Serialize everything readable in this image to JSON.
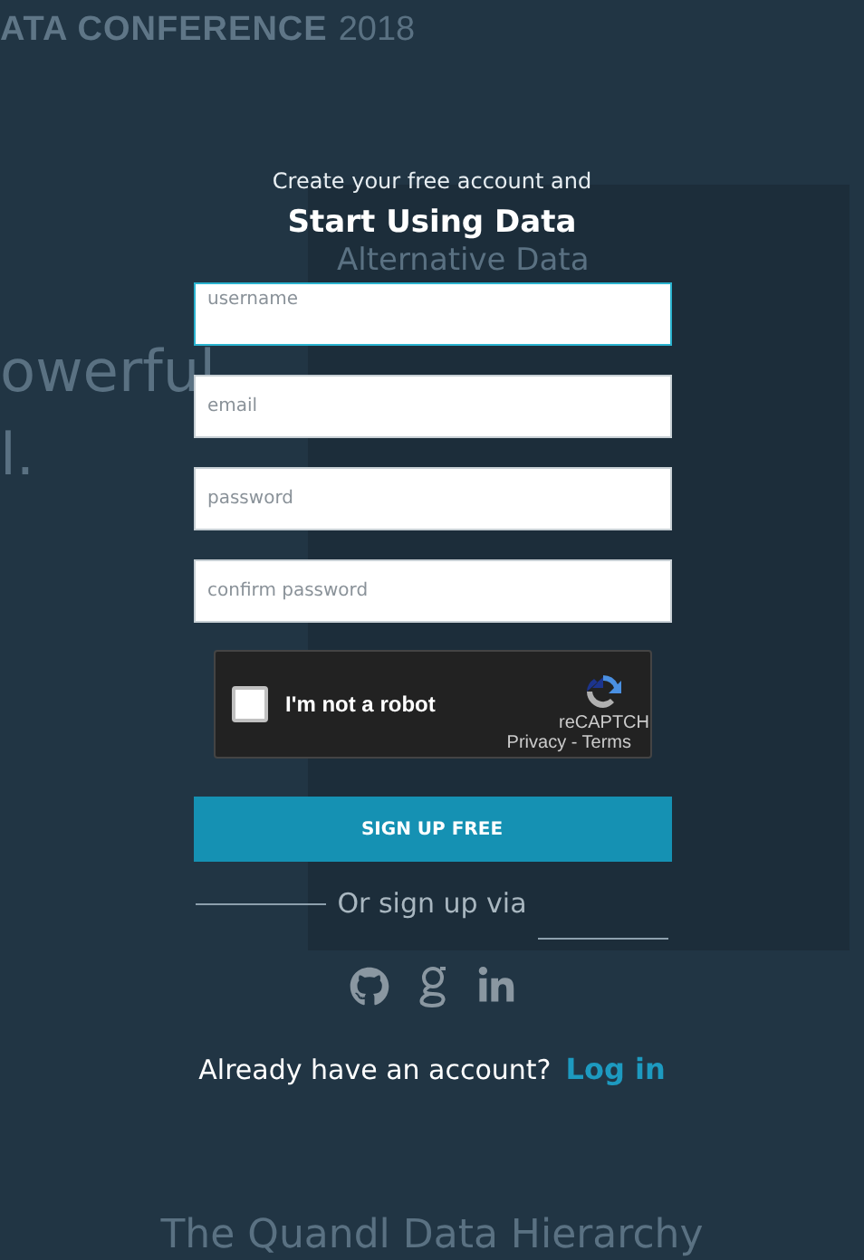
{
  "background": {
    "header_title": "ATA CONFERENCE",
    "header_year": "2018",
    "hero_lines": [
      "owerful",
      "l."
    ],
    "panel_title": "Alternative Data",
    "bottom_heading": "The Quandl Data Hierarchy"
  },
  "signup": {
    "intro": "Create your free account and",
    "title": "Start Using Data",
    "fields": [
      {
        "placeholder": "username",
        "focused": true
      },
      {
        "placeholder": "email",
        "focused": false
      },
      {
        "placeholder": "password",
        "focused": false
      },
      {
        "placeholder": "confirm password",
        "focused": false
      }
    ],
    "captcha": {
      "label": "I'm not a robot",
      "checked": false,
      "brand": "reCAPTCH",
      "links": "Privacy - Terms"
    },
    "submit": "SIGN UP FREE",
    "divider": "Or sign up via",
    "social": [
      {
        "kind": "github"
      },
      {
        "kind": "google"
      },
      {
        "kind": "linkedin"
      }
    ],
    "login_prompt": "Already have an account?",
    "login_link": "Log in"
  }
}
